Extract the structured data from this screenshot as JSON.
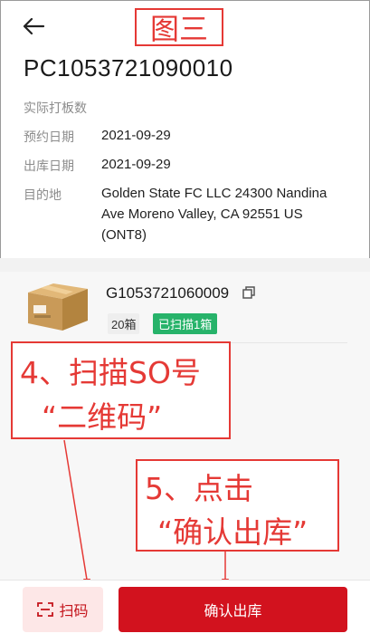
{
  "header": {
    "annotation_title": "图三",
    "order_number": "PC1053721090010"
  },
  "details": {
    "pallets_label": "实际打板数",
    "pallets_value": "",
    "booking_date_label": "预约日期",
    "booking_date_value": "2021-09-29",
    "outbound_date_label": "出库日期",
    "outbound_date_value": "2021-09-29",
    "destination_label": "目的地",
    "destination_value": "Golden State FC LLC 24300 Nandina Ave Moreno Valley, CA 92551 US (ONT8)"
  },
  "item": {
    "code": "G1053721060009",
    "quantity_tag": "20箱",
    "scanned_tag": "已扫描1箱"
  },
  "annotations": {
    "step4_line1": "4、扫描SO号",
    "step4_line2": "“二维码”",
    "step5_line1": "5、点击",
    "step5_line2": "“确认出库”"
  },
  "bottom_bar": {
    "scan_label": "扫码",
    "confirm_label": "确认出库"
  },
  "colors": {
    "primary_red": "#d2121e",
    "annotation_red": "#e53935",
    "scanned_green": "#27b36a"
  },
  "icons": [
    "back-arrow-icon",
    "copy-icon",
    "scan-icon",
    "package-box-icon"
  ]
}
